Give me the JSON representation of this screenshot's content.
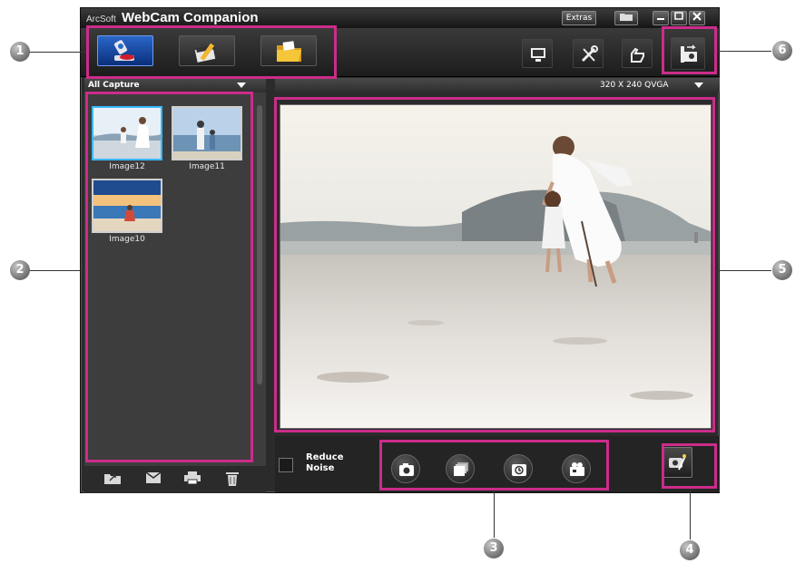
{
  "window": {
    "brand": "ArcSoft",
    "title": "WebCam Companion",
    "extras_label": "Extras"
  },
  "capture_filter": {
    "selected": "All Capture"
  },
  "resolution": {
    "selected": "320 X 240 QVGA"
  },
  "thumbnails": [
    {
      "label": "Image12",
      "selected": true
    },
    {
      "label": "Image11",
      "selected": false
    },
    {
      "label": "Image10",
      "selected": false
    }
  ],
  "reduce_noise": {
    "line1": "Reduce",
    "line2": "Noise",
    "checked": false
  },
  "callouts": [
    "1",
    "2",
    "3",
    "4",
    "5",
    "6"
  ],
  "colors": {
    "highlight": "#cc2c8b",
    "active_blue": "#1f57c0",
    "selection": "#37b9ff",
    "window_bg": "#2b2b2b"
  },
  "icons": {
    "capture_mode": "webcam-icon",
    "edit_mode": "clapper-pencil-icon",
    "browse_mode": "folder-icon",
    "monitor": "monitor-icon",
    "tools": "tools-icon",
    "help": "hand-icon",
    "camera_settings": "camera-swap-icon",
    "snapshot": "camera-icon",
    "burst": "burst-frames-icon",
    "timer": "timer-icon",
    "video": "video-camera-icon",
    "effects": "camera-effects-icon",
    "share": "share-folder-icon",
    "email": "envelope-icon",
    "print": "printer-icon",
    "delete": "trash-icon"
  }
}
